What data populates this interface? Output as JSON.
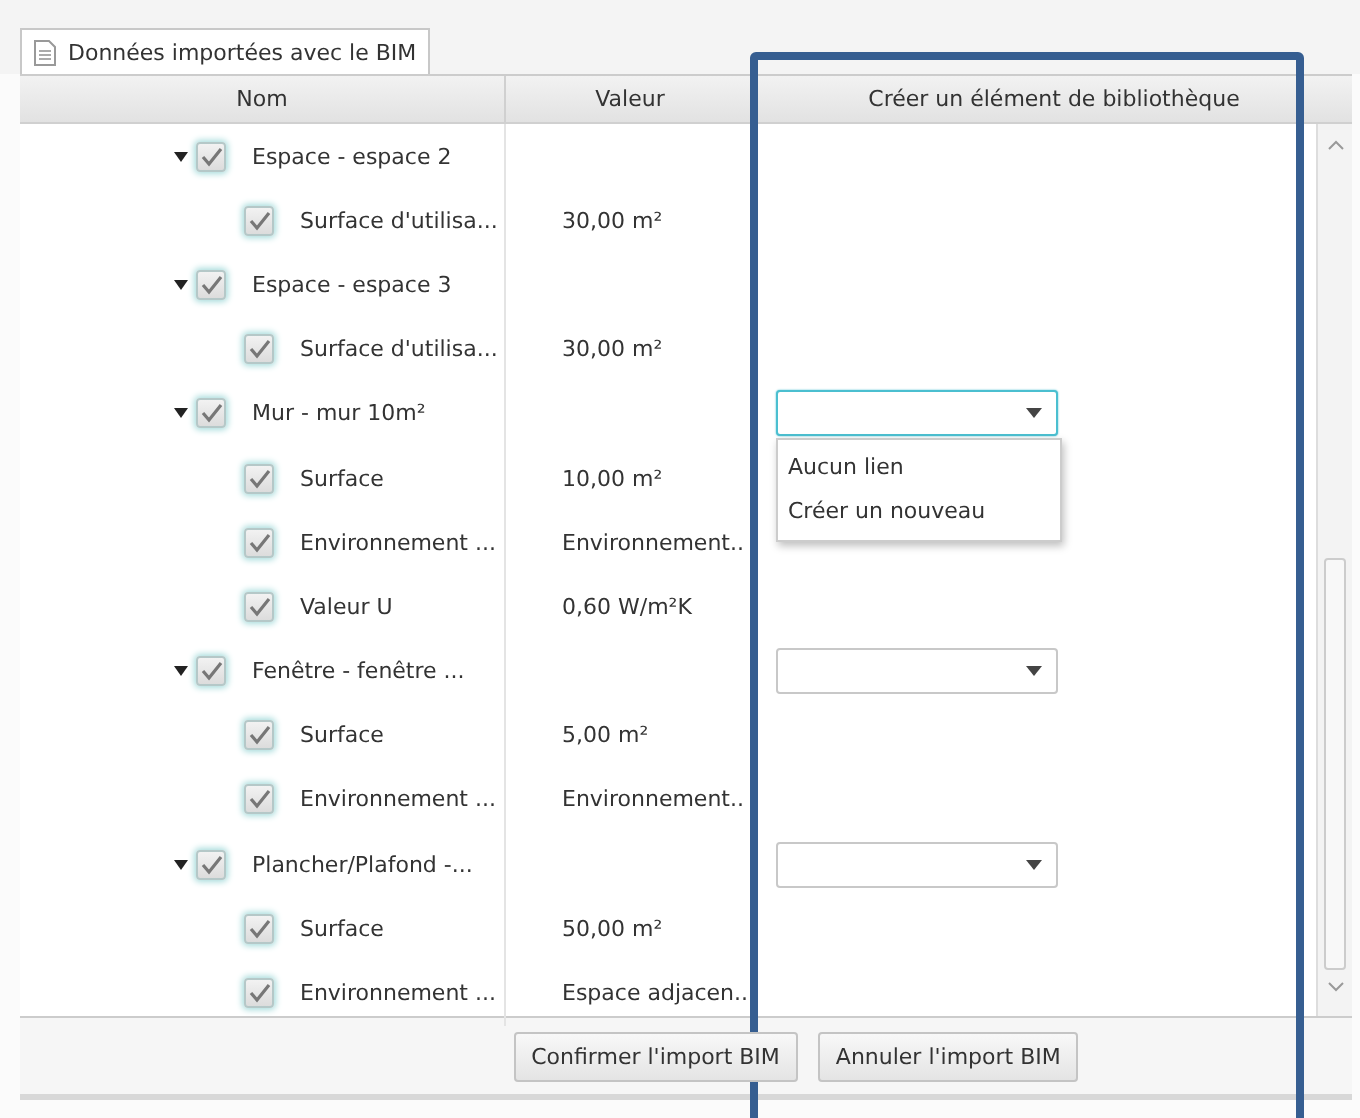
{
  "tab": {
    "label": "Données importées avec le BIM"
  },
  "table": {
    "columns": [
      "Nom",
      "Valeur",
      "Créer un élément de bibliothèque"
    ],
    "rows": [
      {
        "name": "Espace - espace 2",
        "checked": true,
        "expanded": true,
        "children": [
          {
            "name": "Surface d'utilisa...",
            "checked": true,
            "value": "30,00 m²"
          }
        ]
      },
      {
        "name": "Espace - espace 3",
        "checked": true,
        "expanded": true,
        "children": [
          {
            "name": "Surface d'utilisa...",
            "checked": true,
            "value": "30,00 m²"
          }
        ]
      },
      {
        "name": "Mur - mur 10m²",
        "checked": true,
        "expanded": true,
        "link": {
          "focused": true,
          "menu": [
            "Aucun lien",
            "Créer un nouveau"
          ]
        },
        "children": [
          {
            "name": "Surface",
            "checked": true,
            "value": "10,00 m²"
          },
          {
            "name": "Environnement ...",
            "checked": true,
            "value": "Environnement.."
          },
          {
            "name": "Valeur U",
            "checked": true,
            "value": "0,60 W/m²K"
          }
        ]
      },
      {
        "name": "Fenêtre - fenêtre ...",
        "checked": true,
        "expanded": true,
        "link": {
          "focused": false
        },
        "children": [
          {
            "name": "Surface",
            "checked": true,
            "value": "5,00 m²"
          },
          {
            "name": "Environnement ...",
            "checked": true,
            "value": "Environnement.."
          }
        ]
      },
      {
        "name": "Plancher/Plafond -...",
        "checked": true,
        "expanded": true,
        "link": {
          "focused": false
        },
        "children": [
          {
            "name": "Surface",
            "checked": true,
            "value": "50,00 m²"
          },
          {
            "name": "Environnement ...",
            "checked": true,
            "value": "Espace adjacen.."
          }
        ]
      }
    ]
  },
  "buttons": [
    "Confirmer l'import BIM",
    "Annuler l'import BIM"
  ]
}
